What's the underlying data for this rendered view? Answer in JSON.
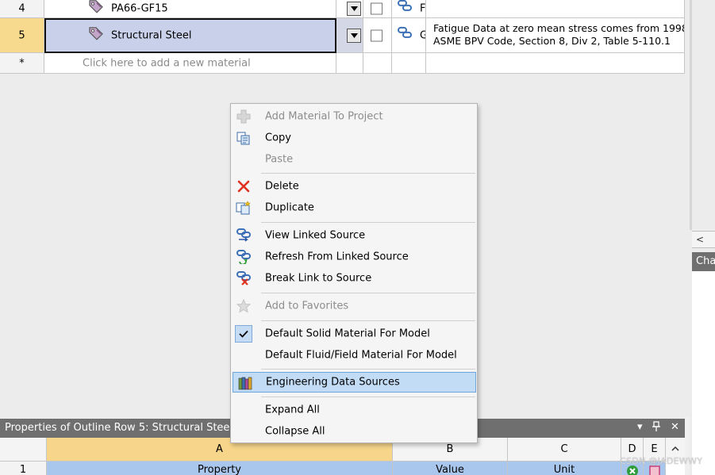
{
  "outline": {
    "rows": [
      {
        "num": "4",
        "name": "PA66-GF15",
        "source_letter": "F",
        "description_lines": []
      },
      {
        "num": "5",
        "name": "Structural Steel",
        "source_letter": "G",
        "description_lines": [
          "Fatigue Data at zero mean stress comes from 1998",
          "ASME BPV Code, Section 8, Div 2, Table 5-110.1"
        ]
      }
    ],
    "new_row": {
      "marker": "*",
      "placeholder": "Click here to add a new material"
    }
  },
  "context_menu": {
    "items": [
      {
        "label": "Add Material To Project",
        "icon": "add-icon",
        "enabled": false
      },
      {
        "label": "Copy",
        "icon": "copy-icon",
        "enabled": true
      },
      {
        "label": "Paste",
        "icon": "",
        "enabled": false
      },
      {
        "label": "Delete",
        "icon": "delete-icon",
        "enabled": true
      },
      {
        "label": "Duplicate",
        "icon": "duplicate-icon",
        "enabled": true
      },
      {
        "label": "View Linked Source",
        "icon": "view-link-icon",
        "enabled": true
      },
      {
        "label": "Refresh From Linked Source",
        "icon": "refresh-link-icon",
        "enabled": true
      },
      {
        "label": "Break Link to Source",
        "icon": "break-link-icon",
        "enabled": true
      },
      {
        "label": "Add to Favorites",
        "icon": "star-icon",
        "enabled": false
      },
      {
        "label": "Default Solid Material For Model",
        "icon": "checkmark-icon",
        "enabled": true,
        "checked": true
      },
      {
        "label": "Default Fluid/Field Material For Model",
        "icon": "",
        "enabled": true
      },
      {
        "label": "Engineering Data Sources",
        "icon": "books-icon",
        "enabled": true,
        "highlighted": true
      },
      {
        "label": "Expand All",
        "icon": "",
        "enabled": true
      },
      {
        "label": "Collapse All",
        "icon": "",
        "enabled": true
      }
    ]
  },
  "right_panel": {
    "scroll_glyph": "<",
    "header": "Cha"
  },
  "properties": {
    "title": "Properties of Outline Row 5: Structural Steel",
    "controls": {
      "dropdown": "▾",
      "pin": "📌",
      "close": "✕"
    },
    "columns": [
      "A",
      "B",
      "C",
      "D",
      "E"
    ],
    "header_row": {
      "num": "1",
      "property": "Property",
      "value": "Value",
      "unit": "Unit"
    }
  },
  "watermark": "CSDN @JADEWWY",
  "colors": {
    "selected_row": "#c9d1ea",
    "selected_num": "#f8da8f",
    "highlight": "#c3dcf6",
    "header_gray": "#6f6f6f"
  }
}
